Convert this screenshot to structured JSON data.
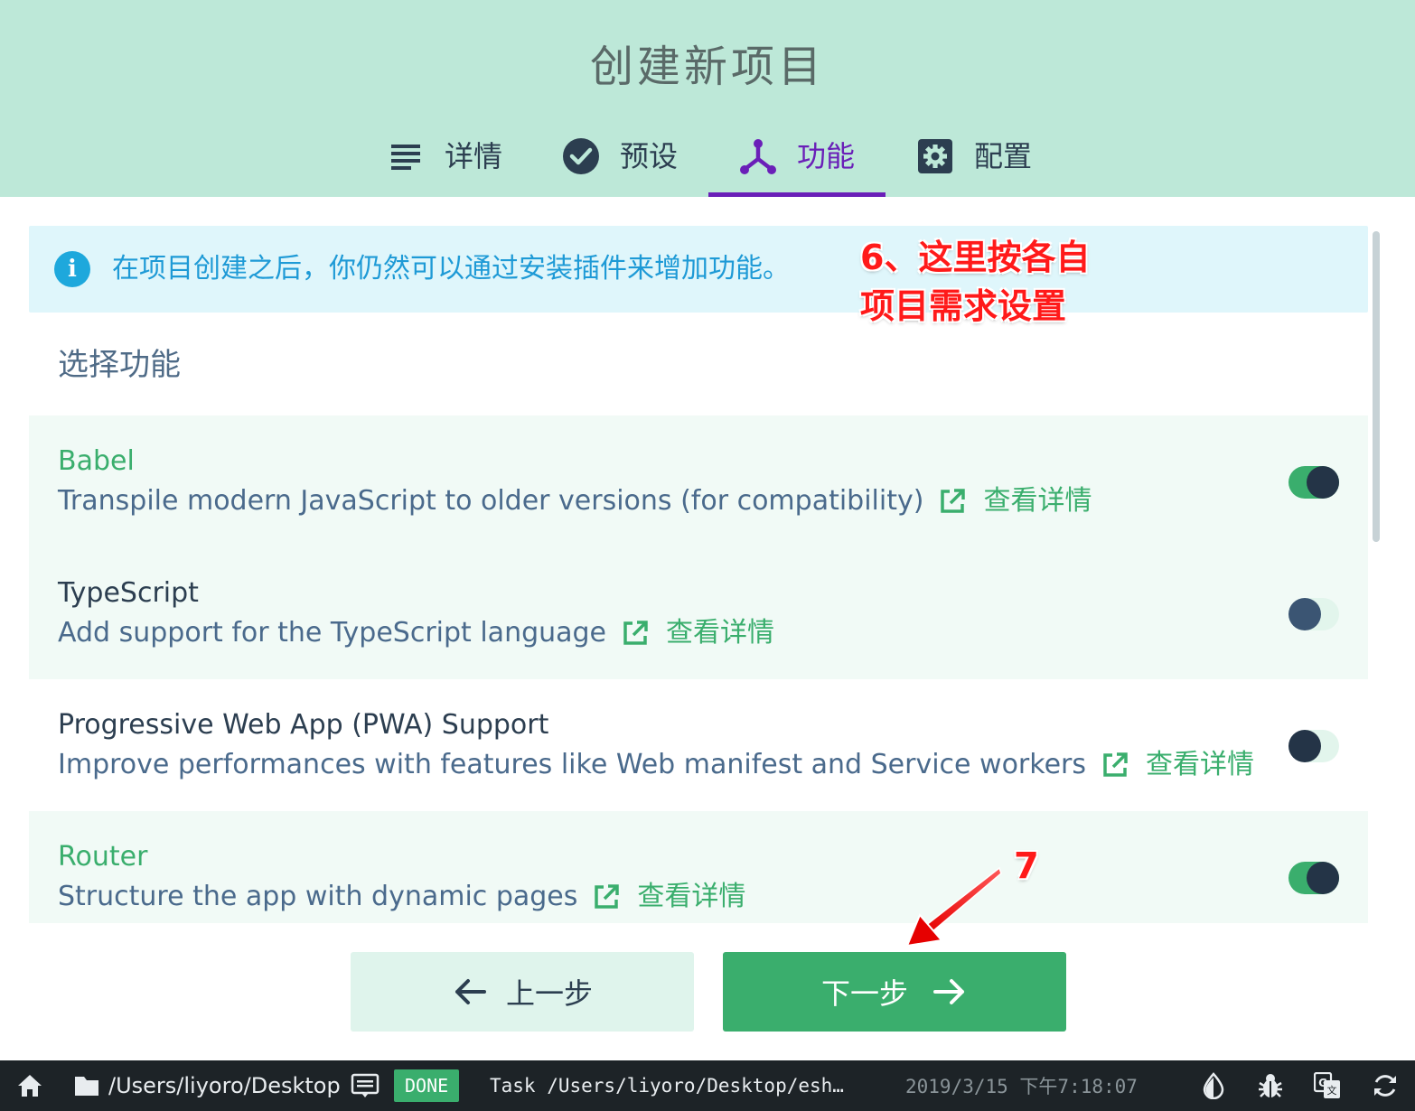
{
  "header": {
    "title": "创建新项目",
    "tabs": [
      {
        "label": "详情",
        "icon": "list-icon"
      },
      {
        "label": "预设",
        "icon": "check-circle-icon"
      },
      {
        "label": "功能",
        "icon": "fork-icon",
        "active": true
      },
      {
        "label": "配置",
        "icon": "gear-icon"
      }
    ]
  },
  "info_banner": {
    "icon": "info-icon",
    "text": "在项目创建之后，你仍然可以通过安装插件来增加功能。"
  },
  "annotations": {
    "step6_line1": "6、这里按各自",
    "step6_line2": "项目需求设置",
    "step7": "7"
  },
  "section_title": "选择功能",
  "features": [
    {
      "name": "Babel",
      "description": "Transpile modern JavaScript to older versions (for compatibility)",
      "more_label": "查看详情",
      "enabled": true
    },
    {
      "name": "TypeScript",
      "description": "Add support for the TypeScript language",
      "more_label": "查看详情",
      "enabled": false
    },
    {
      "name": "Progressive Web App (PWA) Support",
      "description": "Improve performances with features like Web manifest and Service workers",
      "more_label": "查看详情",
      "enabled": false
    },
    {
      "name": "Router",
      "description": "Structure the app with dynamic pages",
      "more_label": "查看详情",
      "enabled": true
    }
  ],
  "buttons": {
    "prev_label": "上一步",
    "next_label": "下一步"
  },
  "statusbar": {
    "path": "/Users/liyoro/Desktop",
    "status": "DONE",
    "task": "Task  /Users/liyoro/Desktop/esh…",
    "time": "2019/3/15  下午7:18:07"
  },
  "colors": {
    "header_bg": "#bde8d8",
    "accent_green": "#3aae6d",
    "active_tab": "#6a1fb8",
    "info_blue": "#1e9ad6",
    "annotation_red": "#ff1a1a"
  }
}
